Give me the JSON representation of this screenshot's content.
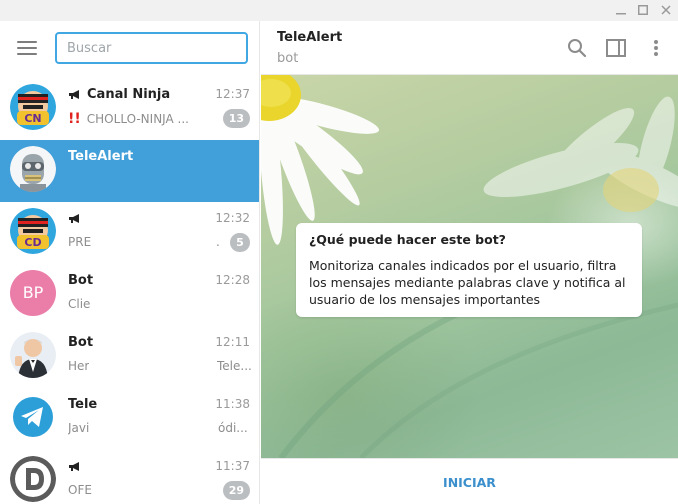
{
  "window": {
    "controls": [
      "minimize-icon",
      "maximize-icon",
      "close-icon"
    ]
  },
  "sidebar": {
    "search_placeholder": "Buscar",
    "chats": [
      {
        "name": "Canal Ninja",
        "time": "12:37",
        "preview": "CHOLLO-NINJA ...",
        "badge": "13",
        "type": "channel",
        "warning": "!!"
      },
      {
        "name": "TeleAlert",
        "time": "",
        "preview": "",
        "badge": "",
        "type": "bot",
        "active": true
      },
      {
        "name": "",
        "time": "12:32",
        "preview": "PRE",
        "preview_end": ".",
        "badge": "5",
        "type": "channel"
      },
      {
        "name": "Bot",
        "time": "12:28",
        "preview": "Clie",
        "badge": "",
        "initials": "BP"
      },
      {
        "name": "Bot",
        "time": "12:11",
        "preview": "Her",
        "preview_end": "Tele...",
        "badge": ""
      },
      {
        "name": "Tele",
        "time": "11:38",
        "preview": "Javi",
        "preview_end": "ódi...",
        "badge": ""
      },
      {
        "name": "",
        "time": "11:37",
        "preview": "OFE",
        "badge": "29",
        "type": "channel"
      }
    ]
  },
  "main": {
    "title": "TeleAlert",
    "status": "bot",
    "info": {
      "title": "¿Qué puede hacer este bot?",
      "body": "Monitoriza canales indicados por el usuario, filtra los mensajes mediante palabras clave y notifica al usuario de los mensajes importantes"
    },
    "start_label": "INICIAR"
  },
  "colors": {
    "accent": "#40a7e3",
    "active_row": "#419fd9",
    "badge": "#bbbec1",
    "avatar_bp": "#eb7ea8"
  }
}
